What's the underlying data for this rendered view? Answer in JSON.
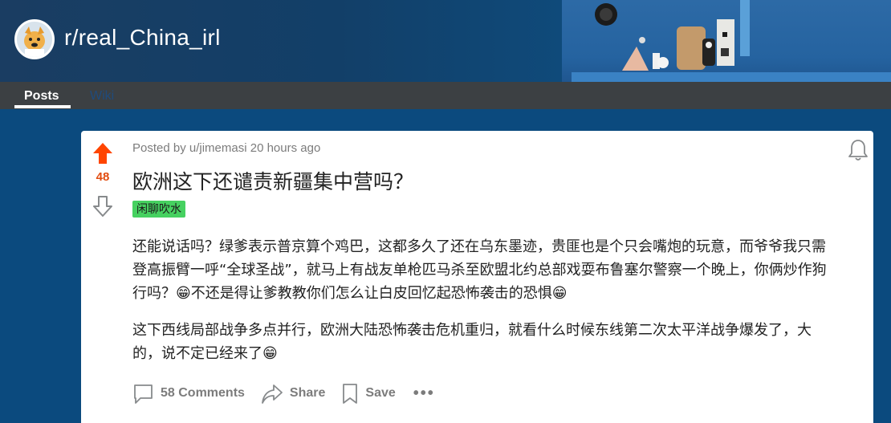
{
  "subreddit": {
    "name": "r/real_China_irl"
  },
  "tabs": [
    {
      "label": "Posts",
      "active": true
    },
    {
      "label": "Wiki",
      "active": false
    }
  ],
  "post": {
    "score": "48",
    "meta": "Posted by u/jimemasi 20 hours ago",
    "title": "欧洲这下还谴责新疆集中营吗？",
    "flair": "闲聊吹水",
    "paragraphs": [
      "还能说话吗？绿爹表示普京算个鸡巴，这都多久了还在乌东墨迹，贵匪也是个只会嘴炮的玩意，而爷爷我只需登高振臂一呼“全球圣战”，就马上有战友单枪匹马杀至欧盟北约总部戏耍布鲁塞尔警察一个晚上，你俩炒作狗行吗？😁不还是得让爹教教你们怎么让白皮回忆起恐怖袭击的恐惧😁",
      "这下西线局部战争多点并行，欧洲大陆恐怖袭击危机重归，就看什么时候东线第二次太平洋战争爆发了，大的，说不定已经来了😁"
    ],
    "actions": {
      "comments": "58 Comments",
      "share": "Share",
      "save": "Save",
      "more": "•••"
    }
  },
  "colors": {
    "upvote": "#ff4500",
    "score": "#e24c0f",
    "flair_bg": "#46d160",
    "page_bg": "#0b4a7e"
  }
}
